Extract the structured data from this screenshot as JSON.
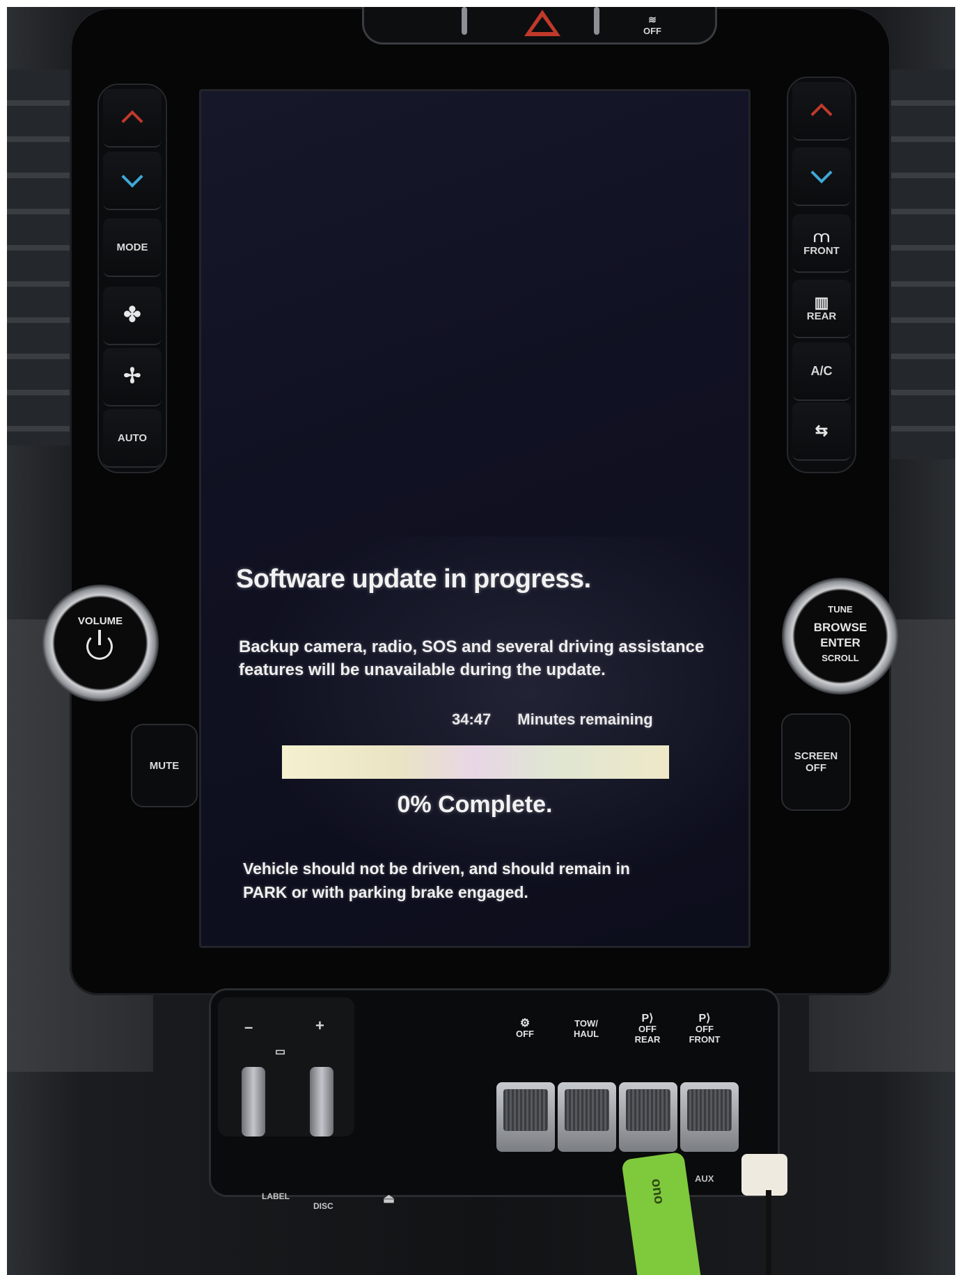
{
  "hazard_bar": {
    "traction_label": "OFF"
  },
  "left_controls": {
    "mode_label": "MODE",
    "auto_label": "AUTO",
    "volume_label": "VOLUME",
    "mute_label": "MUTE"
  },
  "right_controls": {
    "front_label": "FRONT",
    "rear_label": "REAR",
    "ac_label": "A/C",
    "tune_label": "TUNE",
    "browse_label": "BROWSE",
    "enter_label": "ENTER",
    "scroll_label": "SCROLL",
    "screen_off_label": "SCREEN\nOFF"
  },
  "update_screen": {
    "title": "Software update in progress.",
    "description": "Backup camera, radio, SOS and several driving assistance features will be unavailable during the update.",
    "time_remaining": "34:47",
    "time_label": "Minutes remaining",
    "progress_percent": 0,
    "progress_text": "0% Complete.",
    "warning": "Vehicle should not be driven, and should remain in PARK or with parking brake engaged."
  },
  "lower_console": {
    "trailer_minus": "–",
    "trailer_plus": "+",
    "buttons": [
      {
        "label": "OFF",
        "icon": "traction-control-icon"
      },
      {
        "label": "TOW/\nHAUL",
        "icon": ""
      },
      {
        "label": "OFF\nREAR",
        "icon": "park-assist-icon"
      },
      {
        "label": "OFF\nFRONT",
        "icon": "park-assist-icon"
      }
    ],
    "label_text": "LABEL",
    "disc_text": "DISC",
    "aux_text": "AUX",
    "usb_brand": "ono"
  },
  "colors": {
    "hazard_red": "#c0392b",
    "temp_up_red": "#c0392b",
    "temp_down_blue": "#3ea8d8",
    "usb_green": "#7fc93d"
  }
}
